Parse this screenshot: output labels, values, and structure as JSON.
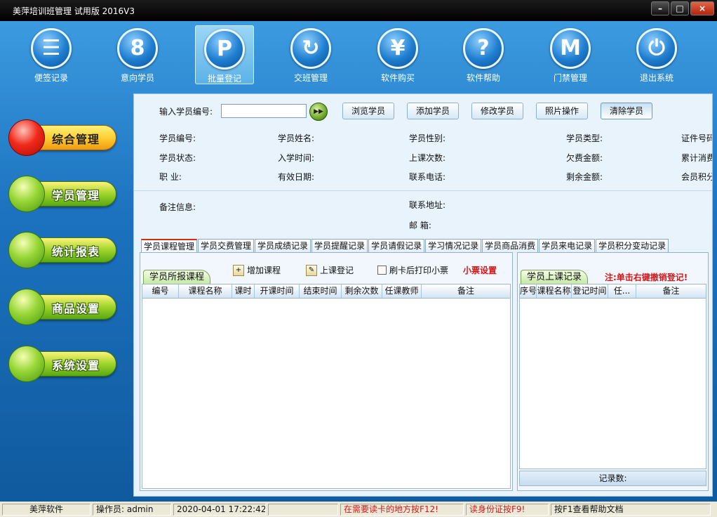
{
  "window": {
    "title": "美萍培训班管理 试用版  2016V3",
    "minimize": "–",
    "maximize": "□",
    "close": "×"
  },
  "toolbar": [
    {
      "label": "便签记录",
      "icon": "notepad-icon",
      "glyph": "☰"
    },
    {
      "label": "意向学员",
      "icon": "person-icon",
      "glyph": "8"
    },
    {
      "label": "批量登记",
      "icon": "p-icon",
      "glyph": "P",
      "selected": true
    },
    {
      "label": "交班管理",
      "icon": "refresh-icon",
      "glyph": "↻"
    },
    {
      "label": "软件购买",
      "icon": "yen-icon",
      "glyph": "¥"
    },
    {
      "label": "软件帮助",
      "icon": "help-icon",
      "glyph": "?"
    },
    {
      "label": "门禁管理",
      "icon": "m-icon",
      "glyph": "M"
    },
    {
      "label": "退出系统",
      "icon": "power-icon",
      "glyph": "⏻"
    }
  ],
  "sidemenu": [
    {
      "label": "综合管理",
      "active": true
    },
    {
      "label": "学员管理"
    },
    {
      "label": "统计报表"
    },
    {
      "label": "商品设置"
    },
    {
      "label": "系统设置"
    }
  ],
  "search": {
    "label": "输入学员编号:",
    "value": "",
    "buttons": [
      "浏览学员",
      "添加学员",
      "修改学员",
      "照片操作",
      "清除学员"
    ]
  },
  "info": {
    "student_no": "学员编号:",
    "student_name": "学员姓名:",
    "gender": "学员性别:",
    "type": "学员类型:",
    "id_no": "证件号码",
    "status": "学员状态:",
    "enroll_date": "入学时间:",
    "class_count": "上课次数:",
    "owed": "欠费金额:",
    "total_spent": "累计消费",
    "job": "职      业:",
    "valid_date": "有效日期:",
    "phone": "联系电话:",
    "balance": "剩余金额:",
    "points": "会员积分",
    "remark": "备注信息:",
    "address": "联系地址:",
    "postcode": "邮      箱:"
  },
  "tabs": [
    "学员课程管理",
    "学员交费管理",
    "学员成绩记录",
    "学员提醒记录",
    "学员请假记录",
    "学习情况记录",
    "学员商品消费",
    "学员来电记录",
    "学员积分变动记录"
  ],
  "left_pane": {
    "subtab": "学员所报课程",
    "add_course": "增加课程",
    "checkin": "上课登记",
    "print_after_swipe": "刷卡后打印小票",
    "receipt_setting": "小票设置",
    "columns": [
      "编号",
      "课程名称",
      "课时",
      "开课时间",
      "结束时间",
      "剩余次数",
      "任课教师",
      "备注"
    ]
  },
  "right_pane": {
    "subtab": "学员上课记录",
    "hint": "注:单击右键撤销登记!",
    "columns": [
      "序号",
      "课程名称",
      "登记时间",
      "任...",
      "备注"
    ],
    "record_count_label": "记录数:"
  },
  "statusbar": {
    "company": "美萍软件",
    "operator": "操作员: admin",
    "datetime": "2020-04-01 17:22:42",
    "blank": "",
    "hint_f12": "在需要读卡的地方按F12!",
    "hint_f9": "读身份证按F9!",
    "hint_f1": "按F1查看帮助文档"
  },
  "colors": {
    "accent_red": "#d21818",
    "bg_blue": "#1c72bf",
    "panel": "#e9f3fb"
  }
}
